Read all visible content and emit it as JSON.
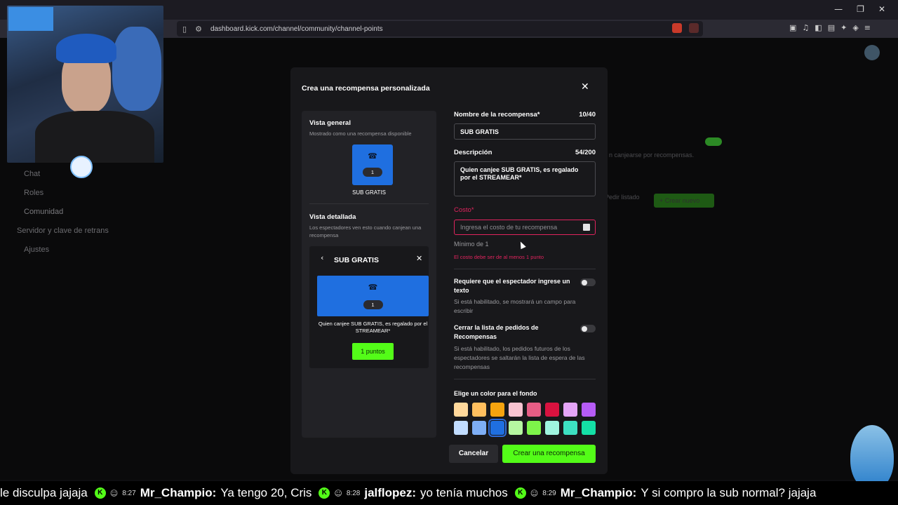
{
  "browser": {
    "url": "dashboard.kick.com/channel/community/channel-points",
    "window_controls": [
      "—",
      "❐",
      "✕"
    ]
  },
  "sidebar": {
    "items": [
      "Chat",
      "Roles",
      "Comunidad",
      "Servidor y clave de retrans",
      "Ajustes"
    ]
  },
  "background": {
    "text": "n canjearse por recompensas.",
    "button1": "Pedir listado",
    "button2": "+ Crear nuevo"
  },
  "modal": {
    "title": "Crea una recompensa personalizada",
    "preview": {
      "general_title": "Vista general",
      "general_sub": "Mostrado como una recompensa disponible",
      "tile_count": "1",
      "tile_label": "SUB GRATIS",
      "detail_title": "Vista detallada",
      "detail_sub": "Los espectadores ven esto cuando canjean una recompensa",
      "card_title": "SUB GRATIS",
      "card_count": "1",
      "card_desc": "Quien canjee SUB GRATIS, es regalado por el STREAMEAR*",
      "card_points": "1 puntos"
    },
    "form": {
      "name_label": "Nombre de la recompensa*",
      "name_count": "10/40",
      "name_value": "SUB GRATIS",
      "desc_label": "Descripción",
      "desc_count": "54/200",
      "desc_value": "Quien canjee SUB GRATIS, es regalado por el STREAMEAR*",
      "cost_label": "Costo*",
      "cost_placeholder": "Ingresa el costo de tu recompensa",
      "cost_hint": "Mínimo de 1",
      "cost_error": "El costo debe ser de al menos 1 punto",
      "opt1_title": "Requiere que el espectador ingrese un texto",
      "opt1_desc": "Si está habilitado, se mostrará un campo para escribir",
      "opt2_title": "Cerrar la lista de pedidos de Recompensas",
      "opt2_desc": "Si está habilitado, los pedidos futuros de los espectadores se saltarán la lista de espera de las recompensas",
      "color_label": "Elige un color para el fondo",
      "colors": [
        "#ffd89b",
        "#ffbf5e",
        "#f5a30f",
        "#f8c3d1",
        "#e65d85",
        "#d9123f",
        "#e4a4f7",
        "#b65cf6",
        "#c1dcff",
        "#7eaef5",
        "#1f6fe0",
        "#b6f7a1",
        "#7ef54a",
        "#9ff5e0",
        "#3de0c2",
        "#14e0a6"
      ],
      "selected_color": "#1f6fe0"
    },
    "cancel": "Cancelar",
    "create": "Crear una recompensa"
  },
  "ticker": [
    {
      "time": "",
      "name": "",
      "msg": "le disculpa jajaja"
    },
    {
      "time": "8:27",
      "name": "Mr_Champio:",
      "msg": "Ya tengo 20, Cris"
    },
    {
      "time": "8:28",
      "name": "jalflopez:",
      "msg": "yo tenía muchos"
    },
    {
      "time": "8:29",
      "name": "Mr_Champio:",
      "msg": "Y si compro la sub normal? jajaja"
    }
  ]
}
